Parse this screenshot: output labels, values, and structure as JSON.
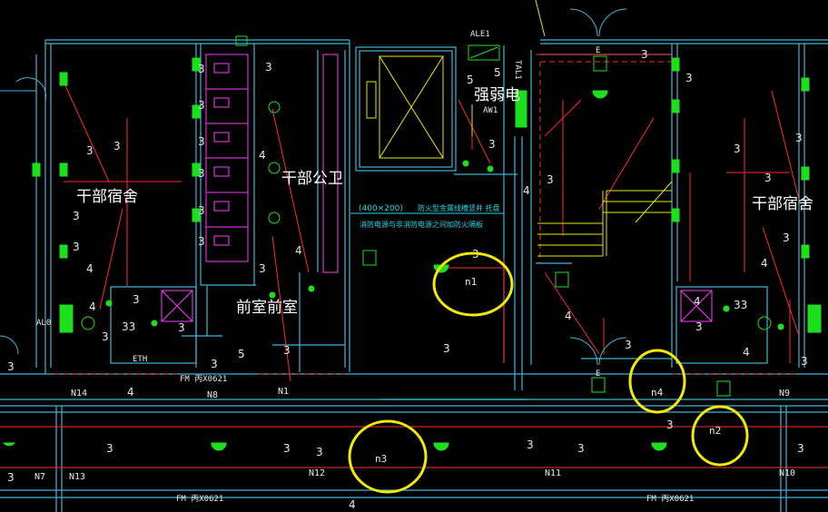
{
  "colors": {
    "background": "#000000",
    "wall": "#3fb6d6",
    "wiring": "#ff2a2a",
    "fixture": "#1de01d",
    "number": "#e8e8e8",
    "room_label": "#ffffff",
    "stair": "#e6e600",
    "elevator": "#e6e600",
    "sanitary": "#ff3bff",
    "note": "#22d6e6",
    "highlight_circle": "#f2ea00"
  },
  "rooms": {
    "dorm_left": "干部宿舍",
    "dorm_right": "干部宿舍",
    "toilet": "干部公卫",
    "vestibule": "前室前室",
    "weak_strong": "强弱电"
  },
  "equipment": {
    "ale1": "ALE1",
    "aw1": "AW1",
    "tal1": "TAL1",
    "al0": "AL0",
    "eth": "ETH",
    "exit_label": "E",
    "fm_left": "FM 丙X0621",
    "fm_bottom_left": "FM 丙X0621",
    "fm_bottom_right": "FM 丙X0621"
  },
  "notes": {
    "duct_size": "(400×200)",
    "duct_label": "防火型金属线槽竖井 托盘",
    "duct_sep": "消防电源与非消防电源之间加防火隔板"
  },
  "circuits": [
    "N14",
    "N8",
    "N1",
    "N13",
    "N12",
    "N11",
    "N9",
    "N10",
    "N7"
  ],
  "highlighted": [
    "n1",
    "n2",
    "n3",
    "n4"
  ],
  "wire_counts": [
    "3",
    "4",
    "5",
    "33"
  ]
}
